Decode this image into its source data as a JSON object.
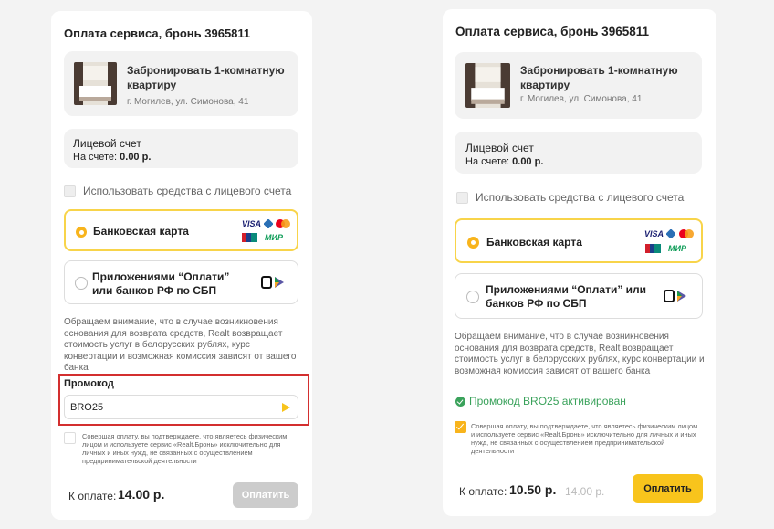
{
  "left": {
    "title": "Оплата сервиса, бронь 3965811",
    "booking": {
      "title": "Забронировать 1-комнатную квартиру",
      "address": "г. Могилев, ул. Симонова, 41"
    },
    "account": {
      "title": "Лицевой счет",
      "balance_label": "На счете:",
      "balance_value": "0.00 р."
    },
    "use_account_label": "Использовать средства с лицевого счета",
    "option_card": "Банковская карта",
    "option_sbp": "Приложениями “Оплати” или банков РФ по СБП",
    "visa_label": "VISA",
    "mir_label": "МИР",
    "note": "Обращаем внимание, что в случае возникновения основания для возврата средств, Realt возвращает стоимость услуг в белорусских рублях, курс конвертации и возможная комиссия зависят от вашего банка",
    "promo_label": "Промокод",
    "promo_value": "BRO25",
    "consent": "Совершая оплату, вы подтверждаете, что являетесь физическим лицом и используете сервис «Realt.Бронь» исключительно для личных и иных нужд, не связанных с осуществлением предпринимательской деятельности",
    "total_label": "К оплате:",
    "total_value": "14.00 р.",
    "pay_button": "Оплатить"
  },
  "right": {
    "title": "Оплата сервиса, бронь 3965811",
    "booking": {
      "title": "Забронировать 1-комнатную квартиру",
      "address": "г. Могилев, ул. Симонова, 41"
    },
    "account": {
      "title": "Лицевой счет",
      "balance_label": "На счете:",
      "balance_value": "0.00 р."
    },
    "use_account_label": "Использовать средства с лицевого счета",
    "option_card": "Банковская карта",
    "option_sbp": "Приложениями “Оплати” или банков РФ по СБП",
    "visa_label": "VISA",
    "mir_label": "МИР",
    "note": "Обращаем внимание, что в случае возникновения основания для возврата средств, Realt возвращает стоимость услуг в белорусских рублях, курс конвертации и возможная комиссия зависят от вашего банка",
    "promo_status": "Промокод BRO25 активирован",
    "consent": "Совершая оплату, вы подтверждаете, что являетесь физическим лицом и используете сервис «Realt.Бронь» исключительно для личных и иных нужд, не связанных с осуществлением предпринимательской деятельности",
    "total_label": "К оплате:",
    "total_value": "10.50 р.",
    "old_total": "14.00 р.",
    "pay_button": "Оплатить"
  },
  "colors": {
    "accent": "#f8c41c",
    "highlight_border": "#d32f2f",
    "success": "#3aa25b",
    "disabled": "#cccccc"
  }
}
